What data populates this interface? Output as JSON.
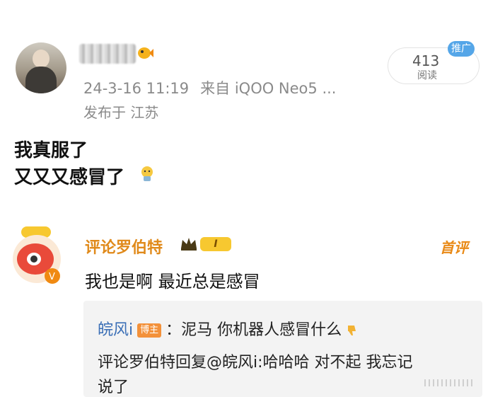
{
  "post": {
    "timestamp": "24-3-16 11:19",
    "source": "来自 iQOO Neo5 ...",
    "location": "发布于 江苏",
    "read_count": "413",
    "read_label": "阅读",
    "promo_tag": "推广",
    "lines": [
      "我真服了",
      "又又又感冒了"
    ]
  },
  "comment": {
    "author": "评论罗伯特",
    "level": "I",
    "first_tag": "首评",
    "text": "我也是啊 最近总是感冒",
    "replies": {
      "r1_name": "皖风i",
      "r1_tag": "博主",
      "r1_text": "：泥马 你机器人感冒什么",
      "r2_line1": "评论罗伯特回复@皖风i:哈哈哈 对不起 我忘记",
      "r2_line2": "说了"
    }
  },
  "colors": {
    "accent_orange": "#e08a1b",
    "link_blue": "#3b6fb6",
    "promo_blue": "#55a6e8"
  },
  "icons": [
    "fish-emoji-icon",
    "fatigue-emoji-icon",
    "crown-icon",
    "thumbs-down-icon",
    "verified-v-icon",
    "dots-watermark-icon"
  ]
}
